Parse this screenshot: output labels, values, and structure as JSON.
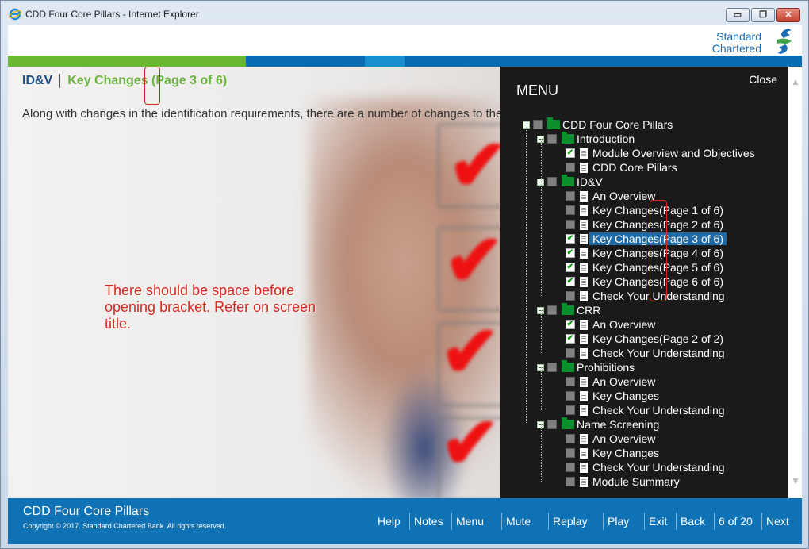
{
  "window": {
    "title": "CDD Four Core Pillars - Internet Explorer",
    "controls": {
      "minimize": "▭",
      "restore": "❐",
      "close": "✕"
    }
  },
  "brand": {
    "line1": "Standard",
    "line2": "Chartered",
    "color": "#1a6eb6"
  },
  "stripe_colors": [
    "#6ab830",
    "#3e9a3a",
    "#0a6cb0",
    "#1a8fd0",
    "#0a6cb0"
  ],
  "screen": {
    "section": "ID&V",
    "title": "Key Changes (Page 3 of 6)",
    "body": "Along with changes in the identification requirements, there are a number of changes to the verification requirements as a result of ICDD."
  },
  "annotation": {
    "text": "There should be space before opening bracket. Refer on screen title.",
    "color": "#d7261e"
  },
  "menu": {
    "title": "MENU",
    "close": "Close",
    "tree": [
      {
        "label": "CDD Four Core Pillars",
        "type": "folder",
        "level": 0,
        "checked": false
      },
      {
        "label": "Introduction",
        "type": "folder",
        "level": 1,
        "checked": false
      },
      {
        "label": "Module Overview and Objectives",
        "type": "page",
        "level": 2,
        "checked": true
      },
      {
        "label": "CDD Core Pillars",
        "type": "page",
        "level": 2,
        "checked": false
      },
      {
        "label": "ID&V",
        "type": "folder",
        "level": 1,
        "checked": false
      },
      {
        "label": "An Overview",
        "type": "page",
        "level": 2,
        "checked": false
      },
      {
        "label": "Key Changes(Page 1 of 6)",
        "type": "page",
        "level": 2,
        "checked": false
      },
      {
        "label": "Key Changes(Page 2 of 6)",
        "type": "page",
        "level": 2,
        "checked": false
      },
      {
        "label": "Key Changes(Page 3 of 6)",
        "type": "page",
        "level": 2,
        "checked": true,
        "selected": true
      },
      {
        "label": "Key Changes(Page 4 of 6)",
        "type": "page",
        "level": 2,
        "checked": true
      },
      {
        "label": "Key Changes(Page 5 of 6)",
        "type": "page",
        "level": 2,
        "checked": true
      },
      {
        "label": "Key Changes(Page 6 of 6)",
        "type": "page",
        "level": 2,
        "checked": true
      },
      {
        "label": "Check Your Understanding",
        "type": "page",
        "level": 2,
        "checked": false
      },
      {
        "label": "CRR",
        "type": "folder",
        "level": 1,
        "checked": false
      },
      {
        "label": "An Overview",
        "type": "page",
        "level": 2,
        "checked": true
      },
      {
        "label": "Key Changes(Page 2 of 2)",
        "type": "page",
        "level": 2,
        "checked": true
      },
      {
        "label": "Check Your Understanding",
        "type": "page",
        "level": 2,
        "checked": false
      },
      {
        "label": "Prohibitions",
        "type": "folder",
        "level": 1,
        "checked": false
      },
      {
        "label": "An Overview",
        "type": "page",
        "level": 2,
        "checked": false
      },
      {
        "label": "Key Changes",
        "type": "page",
        "level": 2,
        "checked": false
      },
      {
        "label": "Check Your Understanding",
        "type": "page",
        "level": 2,
        "checked": false
      },
      {
        "label": "Name Screening",
        "type": "folder",
        "level": 1,
        "checked": false
      },
      {
        "label": "An Overview",
        "type": "page",
        "level": 2,
        "checked": false
      },
      {
        "label": "Key Changes",
        "type": "page",
        "level": 2,
        "checked": false
      },
      {
        "label": "Check Your Understanding",
        "type": "page",
        "level": 2,
        "checked": false
      },
      {
        "label": "Module Summary",
        "type": "page",
        "level": 2,
        "checked": false
      }
    ]
  },
  "footer": {
    "title": "CDD Four Core Pillars",
    "copyright": "Copyright © 2017. Standard Chartered Bank. All rights reserved.",
    "nav": [
      {
        "id": "help",
        "label": "Help"
      },
      {
        "id": "notes",
        "label": "Notes"
      },
      {
        "id": "menu",
        "label": "Menu"
      },
      {
        "id": "mute",
        "label": "Mute"
      },
      {
        "id": "replay",
        "label": "Replay"
      },
      {
        "id": "play",
        "label": "Play"
      },
      {
        "id": "exit",
        "label": "Exit"
      },
      {
        "id": "back",
        "label": "Back"
      },
      {
        "id": "page-counter",
        "label": "6 of 20"
      },
      {
        "id": "next",
        "label": "Next"
      }
    ]
  }
}
